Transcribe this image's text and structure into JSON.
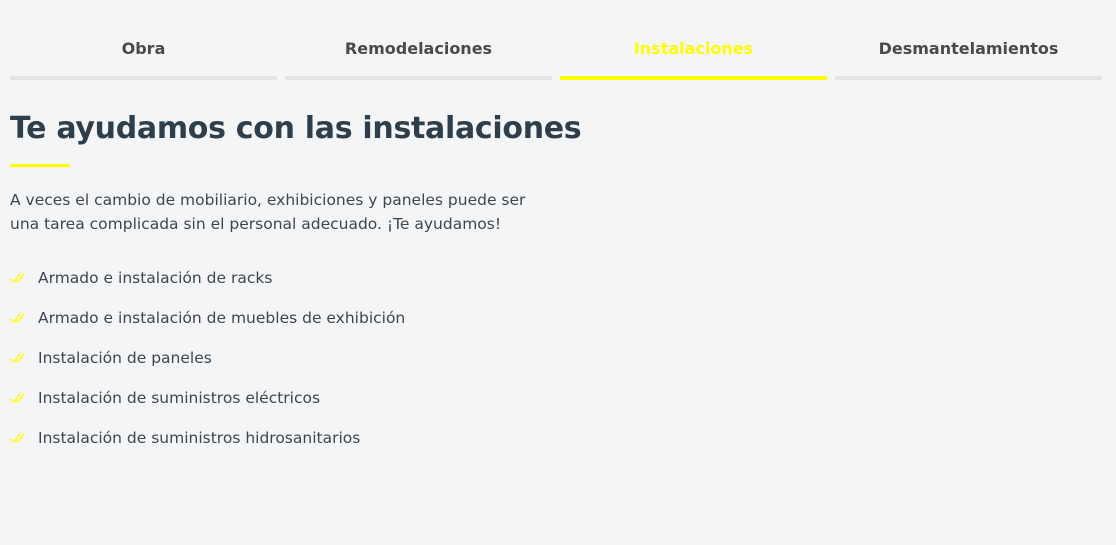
{
  "colors": {
    "background": "#f4f5f7",
    "accent": "#ffff00",
    "heading": "#2e3e4a",
    "text": "#3d4650",
    "tab_inactive_bar": "#e3e4e6"
  },
  "tabs": [
    {
      "label": "Obra",
      "active": false
    },
    {
      "label": "Remodelaciones",
      "active": false
    },
    {
      "label": "Instalaciones",
      "active": true
    },
    {
      "label": "Desmantelamientos",
      "active": false
    }
  ],
  "content": {
    "heading": "Te ayudamos con las instalaciones",
    "intro": "A veces el cambio de mobiliario, exhibiciones y paneles puede ser una tarea complicada sin el personal adecuado. ¡Te ayudamos!",
    "check_icon": "double-check-icon",
    "features": [
      "Armado e instalación de racks",
      "Armado e instalación de muebles de exhibición",
      "Instalación de paneles",
      "Instalación de suministros eléctricos",
      "Instalación de suministros hidrosanitarios"
    ]
  }
}
